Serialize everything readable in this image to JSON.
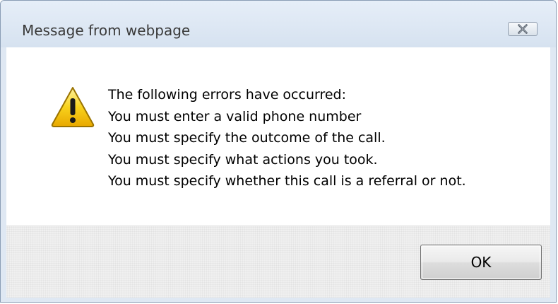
{
  "window": {
    "title": "Message from webpage"
  },
  "icons": {
    "warning": "warning-icon",
    "close": "close-icon"
  },
  "message": {
    "lines": [
      "The following errors have occurred:",
      "You must enter a valid phone number",
      "You must specify the outcome of the call.",
      "You must specify what actions you took.",
      "You must specify whether this call is a referral or not."
    ]
  },
  "buttons": {
    "ok_label": "OK"
  },
  "colors": {
    "frame": "#dfe8f3",
    "content_bg": "#ffffff",
    "footer_bg": "#f0f0f0",
    "warning_yellow": "#f5c400"
  }
}
